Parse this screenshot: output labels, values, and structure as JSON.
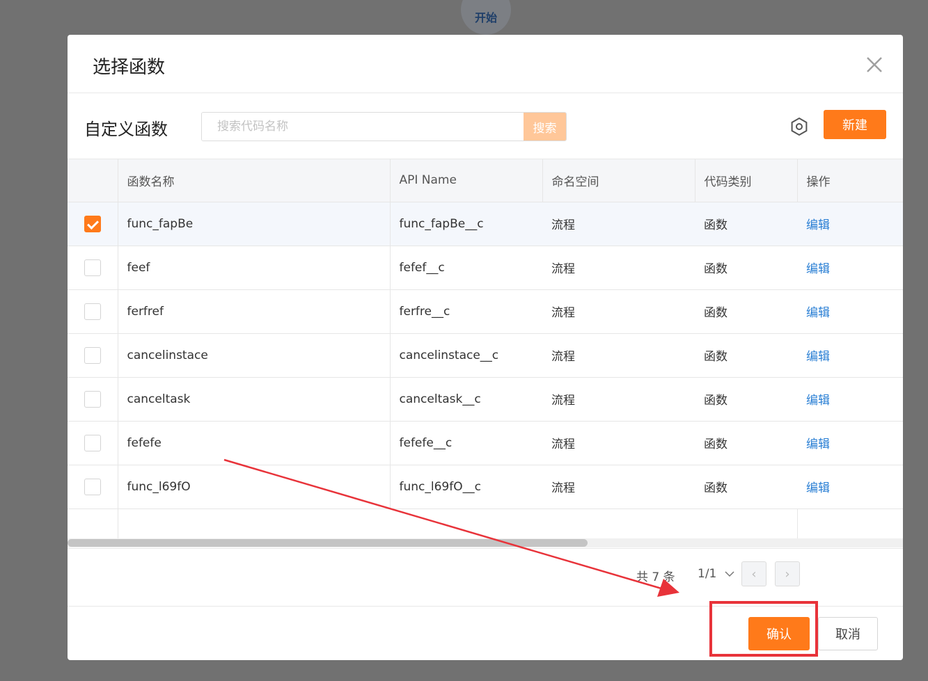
{
  "background": {
    "start_label": "开始"
  },
  "modal": {
    "title": "选择函数",
    "section_title": "自定义函数",
    "search": {
      "placeholder": "搜索代码名称",
      "value": "",
      "button_label": "搜索"
    },
    "new_button_label": "新建",
    "table": {
      "headers": [
        "函数名称",
        "API Name",
        "命名空间",
        "代码类别",
        "操作"
      ],
      "rows": [
        {
          "checked": true,
          "name": "func_fapBe",
          "api_name": "func_fapBe__c",
          "namespace": "流程",
          "category": "函数",
          "action": "编辑"
        },
        {
          "checked": false,
          "name": "feef",
          "api_name": "fefef__c",
          "namespace": "流程",
          "category": "函数",
          "action": "编辑"
        },
        {
          "checked": false,
          "name": "ferfref",
          "api_name": "ferfre__c",
          "namespace": "流程",
          "category": "函数",
          "action": "编辑"
        },
        {
          "checked": false,
          "name": "cancelinstace",
          "api_name": "cancelinstace__c",
          "namespace": "流程",
          "category": "函数",
          "action": "编辑"
        },
        {
          "checked": false,
          "name": "canceltask",
          "api_name": "canceltask__c",
          "namespace": "流程",
          "category": "函数",
          "action": "编辑"
        },
        {
          "checked": false,
          "name": "fefefe",
          "api_name": "fefefe__c",
          "namespace": "流程",
          "category": "函数",
          "action": "编辑"
        },
        {
          "checked": false,
          "name": "func_l69fO",
          "api_name": "func_l69fO__c",
          "namespace": "流程",
          "category": "函数",
          "action": "编辑"
        }
      ]
    },
    "pagination": {
      "total": "共 7 条",
      "page": "1/1",
      "prev": "‹",
      "next": "›"
    },
    "footer": {
      "confirm_label": "确认",
      "cancel_label": "取消"
    }
  },
  "colors": {
    "accent": "#ff7a1a",
    "annotation": "#e8333a",
    "link": "#2a7fd4"
  }
}
